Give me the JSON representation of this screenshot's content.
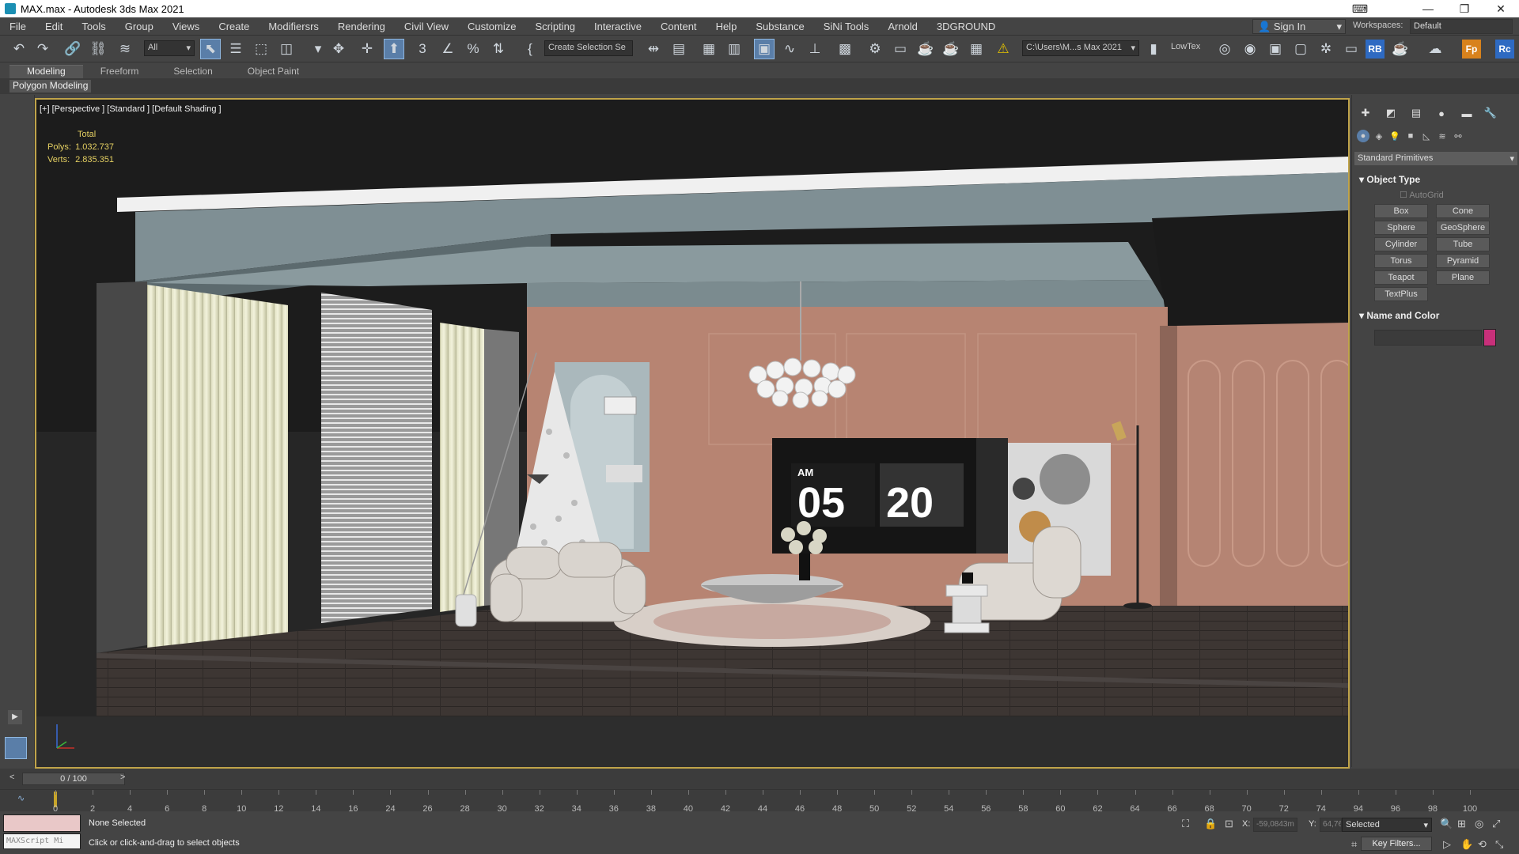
{
  "title": "MAX.max - Autodesk 3ds Max 2021",
  "window_controls": {
    "minimize": "—",
    "restore": "❐",
    "close": "✕",
    "extra": "⌨"
  },
  "menu": [
    "File",
    "Edit",
    "Tools",
    "Group",
    "Views",
    "Create",
    "Modifiersrs",
    "Rendering",
    "Civil View",
    "Customize",
    "Scripting",
    "Interactive",
    "Content",
    "Help",
    "Substance",
    "SiNi Tools",
    "Arnold",
    "3DGROUND"
  ],
  "signin": "Sign In",
  "workspace_label": "Workspaces:",
  "workspace_value": "Default",
  "toolbar": {
    "filter_all": "All",
    "selection_set": "Create Selection Se",
    "project_path": "C:\\Users\\M...s Max 2021",
    "lowtex": "LowTex",
    "rb_label": "RB",
    "fp_label": "Fp",
    "rc_label": "Rc"
  },
  "ribbon_tabs": [
    "Modeling",
    "Freeform",
    "Selection",
    "Object Paint"
  ],
  "ribbon_sub": "Polygon Modeling",
  "viewport": {
    "label": "[+] [Perspective ] [Standard ] [Default Shading ]",
    "stats_total": "Total",
    "polys_label": "Polys:",
    "polys_value": "1.032.737",
    "verts_label": "Verts:",
    "verts_value": "2.835.351",
    "clock_am": "AM",
    "clock_hour": "05",
    "clock_min": "20"
  },
  "command_panel": {
    "dropdown": "Standard Primitives",
    "object_type_title": "Object Type",
    "autogrid": "AutoGrid",
    "buttons": [
      "Box",
      "Cone",
      "Sphere",
      "GeoSphere",
      "Cylinder",
      "Tube",
      "Torus",
      "Pyramid",
      "Teapot",
      "Plane",
      "TextPlus"
    ],
    "name_color_title": "Name and Color",
    "name_value": "",
    "color": "#c8307a"
  },
  "timeline": {
    "frame": "0 / 100",
    "prev": "<",
    "next": ">",
    "ticks": [
      "0",
      "2",
      "4",
      "6",
      "8",
      "10",
      "12",
      "14",
      "16",
      "24",
      "26",
      "28",
      "30",
      "32",
      "34",
      "36",
      "38",
      "40",
      "42",
      "44",
      "46",
      "48",
      "50",
      "52",
      "54",
      "56",
      "58",
      "60",
      "62",
      "64",
      "66",
      "68",
      "70",
      "72",
      "74",
      "94",
      "96",
      "98",
      "100"
    ]
  },
  "status": {
    "maxscript": "MAXScript Mi",
    "selection": "None Selected",
    "prompt": "Click or click-and-drag to select objects",
    "x_label": "X:",
    "x_value": "-59,0843m",
    "y_label": "Y:",
    "y_value": "64,76",
    "selected_set": "Selected",
    "key_filters": "Key Filters..."
  },
  "colors": {
    "accent": "#5a7ea8",
    "viewport_border": "#c0a44a",
    "wall": "#b68470"
  }
}
